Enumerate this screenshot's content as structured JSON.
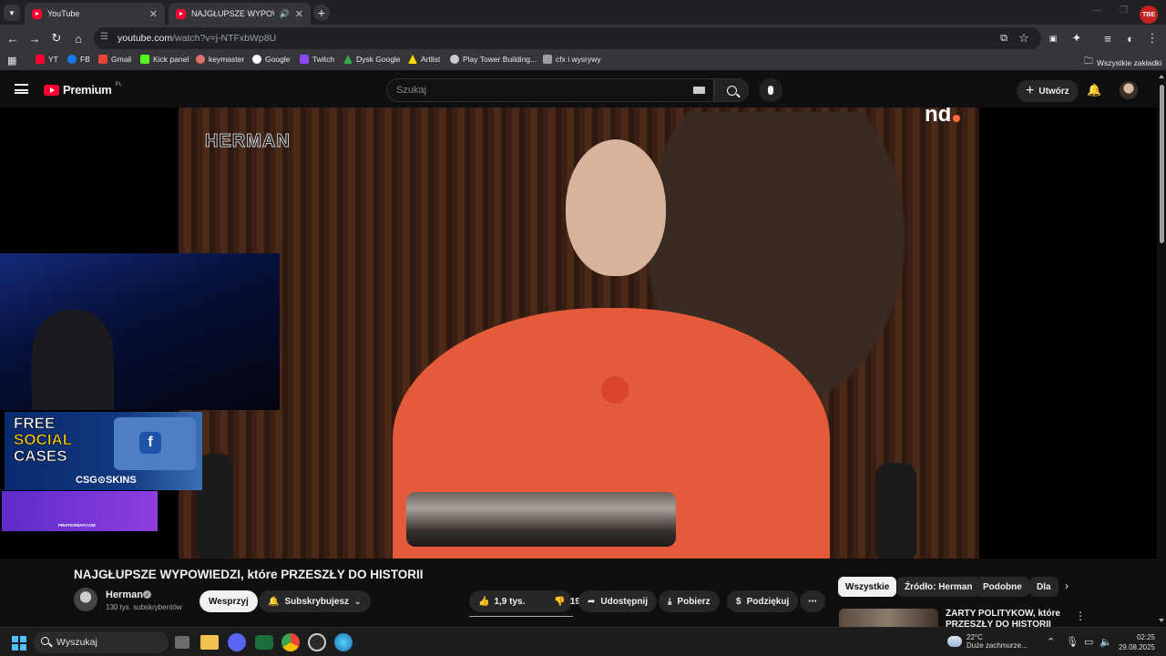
{
  "browser": {
    "tabs": [
      {
        "label": "YouTube",
        "active": false
      },
      {
        "label": "NAJGŁUPSZE WYPOWIEDZI",
        "active": true
      }
    ],
    "url_host": "youtube.com",
    "url_path": "/watch?v=j-NTFxbWp8U",
    "profile_badge": "TBE",
    "bookmarks": [
      {
        "label": "YT",
        "color": "#ff0033"
      },
      {
        "label": "FB",
        "color": "#1877f2"
      },
      {
        "label": "Gmail",
        "color": "#ea4335"
      },
      {
        "label": "Kick panel",
        "color": "#53fc18"
      },
      {
        "label": "keymaster",
        "color": "#e06c6c"
      },
      {
        "label": "Google",
        "color": "#ffffff"
      },
      {
        "label": "Twitch",
        "color": "#9146ff"
      },
      {
        "label": "Dysk Google",
        "color": "#34a853"
      },
      {
        "label": "Artlist",
        "color": "#ffd400"
      },
      {
        "label": "Play Tower Building...",
        "color": "#cccccc"
      },
      {
        "label": "cfx i wysrywy",
        "color": "#9aa0a6"
      }
    ],
    "all_bookmarks": "Wszystkie zakładki"
  },
  "youtube": {
    "logo_word": "Premium",
    "logo_country": "PL",
    "search_placeholder": "Szukaj",
    "create_label": "Utwórz",
    "video": {
      "watermark": "HERMAN",
      "corner_logo": "nd"
    },
    "ads": {
      "csg_line1": "FREE",
      "csg_line2": "SOCIAL",
      "csg_line3": "CASES",
      "csg_brand": "CSG⊙SKINS",
      "csg_box_letter": "f",
      "pirate_label": "PIRATESWAP.COM"
    },
    "title": "NAJGŁUPSZE WYPOWIEDZI, które PRZESZŁY DO HISTORII",
    "channel": {
      "name": "Herman",
      "subscribers": "130 tys. subskrybentów"
    },
    "actions": {
      "support": "Wesprzyj",
      "subscribed": "Subskrybujesz",
      "likes": "1,9 tys.",
      "dislikes": "19",
      "share": "Udostępnij",
      "download": "Pobierz",
      "thanks": "Podziękuj"
    },
    "chips": [
      "Wszystkie",
      "Źródło: Herman",
      "Podobne",
      "Dla"
    ],
    "recommendation_title": "ŻARTY POLITYKÓW, które PRZESZŁY DO HISTORII"
  },
  "taskbar": {
    "search_label": "Wyszukaj",
    "weather_temp": "22°C",
    "weather_desc": "Duże zachmurze...",
    "time": "02:25",
    "date": "29.08.2025"
  }
}
